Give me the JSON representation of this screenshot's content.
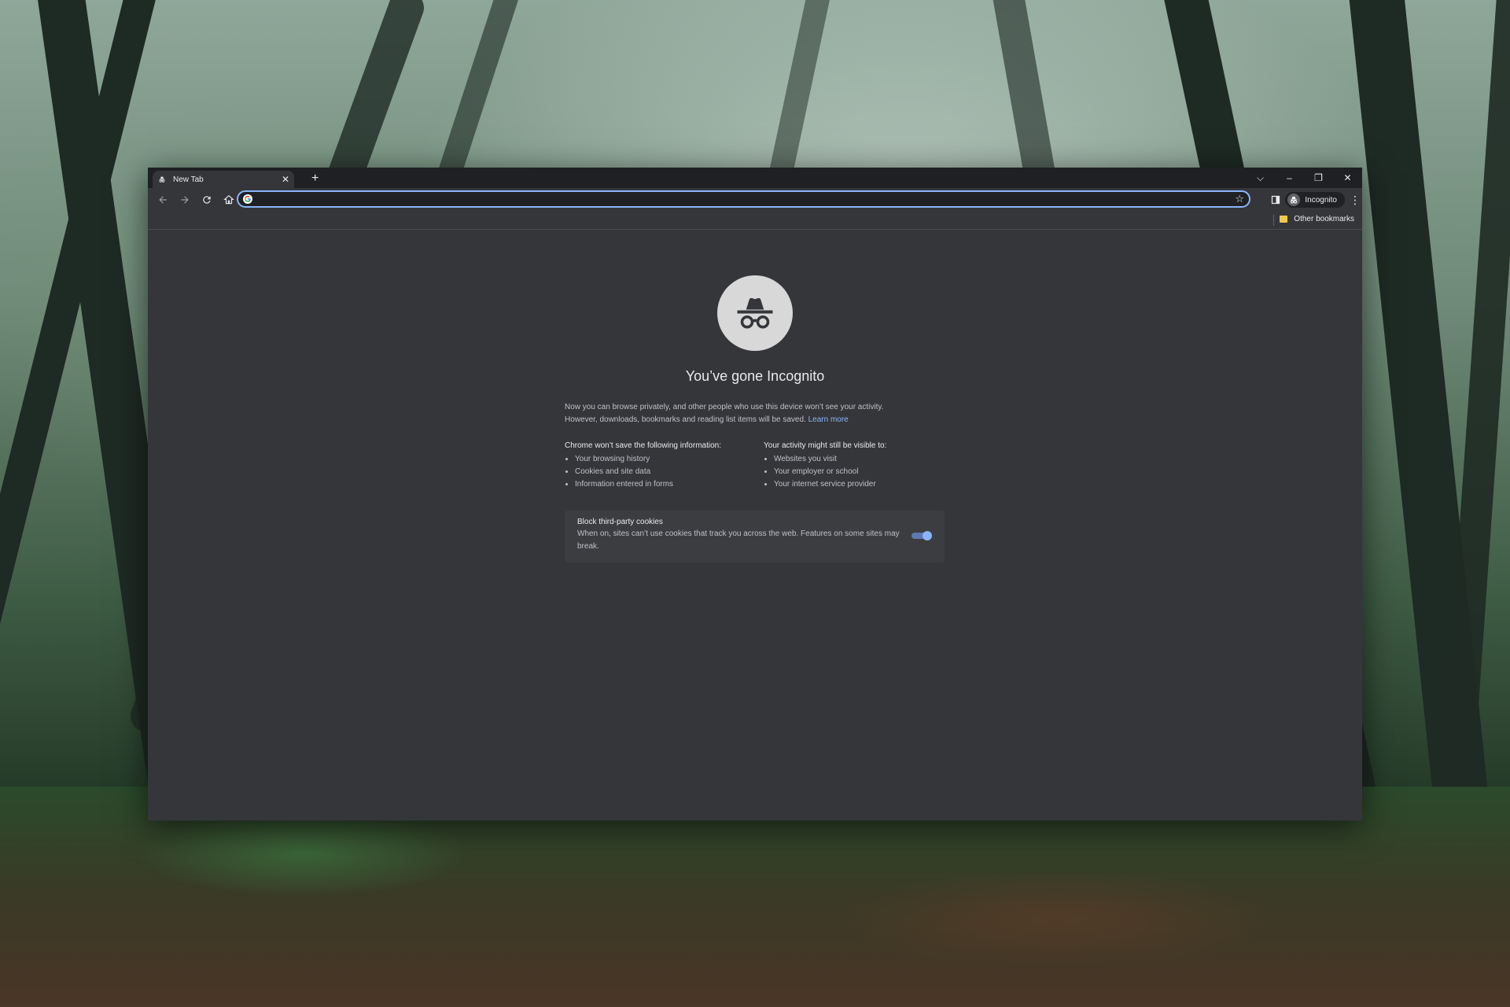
{
  "browser": {
    "tab": {
      "title": "New Tab"
    },
    "window_controls": {
      "minimize": "–",
      "restore": "❐",
      "close": "✕",
      "tab_search": "⌵"
    },
    "omnibox": {
      "value": "",
      "placeholder": ""
    },
    "profile": {
      "label": "Incognito"
    },
    "bookmarks": {
      "other_label": "Other bookmarks"
    }
  },
  "page": {
    "headline": "You’ve gone Incognito",
    "intro_line1": "Now you can browse privately, and other people who use this device won’t see your activity.",
    "intro_line2": "However, downloads, bookmarks and reading list items will be saved.",
    "learn_more": "Learn more",
    "not_saved": {
      "title": "Chrome won’t save the following information:",
      "items": [
        "Your browsing history",
        "Cookies and site data",
        "Information entered in forms"
      ]
    },
    "visible_to": {
      "title": "Your activity might still be visible to:",
      "items": [
        "Websites you visit",
        "Your employer or school",
        "Your internet service provider"
      ]
    },
    "cookies": {
      "title": "Block third-party cookies",
      "description": "When on, sites can’t use cookies that track you across the web. Features on some sites may break.",
      "enabled": true
    }
  },
  "colors": {
    "accent": "#8ab4f8",
    "page_bg": "#35363a",
    "titlebar_bg": "#1f2023"
  }
}
